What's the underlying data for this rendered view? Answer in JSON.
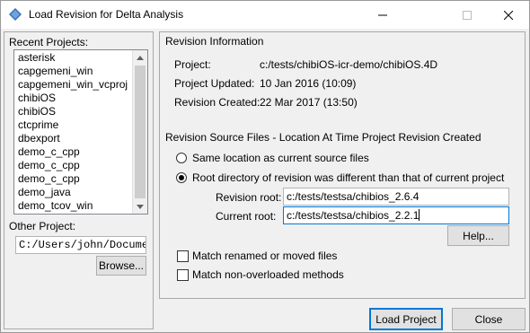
{
  "window": {
    "title": "Load Revision for Delta Analysis",
    "icon": "diamond-app-icon",
    "controls": [
      "minimize-icon",
      "maximize-icon",
      "close-icon"
    ]
  },
  "left": {
    "recent_label": "Recent Projects:",
    "recent_projects": [
      "asterisk",
      "capgemeni_win",
      "capgemeni_win_vcproj",
      "chibiOS",
      "chibiOS",
      "ctcprime",
      "dbexport",
      "demo_c_cpp",
      "demo_c_cpp",
      "demo_c_cpp",
      "demo_java",
      "demo_tcov_win"
    ],
    "other_label": "Other Project:",
    "other_value": "C:/Users/john/Docume",
    "browse_label": "Browse..."
  },
  "revision_info": {
    "heading": "Revision Information",
    "project_label": "Project:",
    "project_value": "c:/tests/chibiOS-icr-demo/chibiOS.4D",
    "updated_label": "Project Updated:",
    "updated_value": "10 Jan 2016 (10:09)",
    "created_label": "Revision Created:",
    "created_value": "22 Mar 2017 (13:50)"
  },
  "source_files": {
    "heading": "Revision Source Files - Location At Time Project Revision Created",
    "option_same": "Same location as current source files",
    "option_root": "Root directory of revision was different than that of current project",
    "selected": "root",
    "revision_root_label": "Revision root:",
    "revision_root_value": "c:/tests/testsa/chibios_2.6.4",
    "current_root_label": "Current root:",
    "current_root_value": "c:/tests/testsa/chibios_2.2.1",
    "help_label": "Help..."
  },
  "options": {
    "match_renamed": "Match renamed or moved files",
    "match_renamed_checked": false,
    "match_non_overloaded": "Match non-overloaded methods",
    "match_non_overloaded_checked": false
  },
  "footer": {
    "load_label": "Load Project",
    "close_label": "Close"
  }
}
